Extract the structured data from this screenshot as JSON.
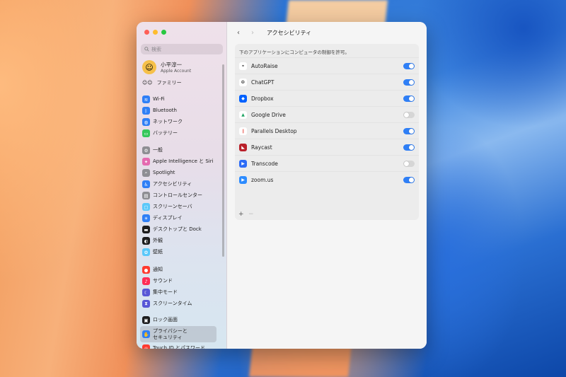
{
  "window": {
    "traffic_colors": [
      "#fe5f57",
      "#febc2e",
      "#28c840"
    ]
  },
  "sidebar": {
    "search_placeholder": "検索",
    "account": {
      "name": "小平淳一",
      "subtitle": "Apple Account",
      "avatar": "memoji-avatar"
    },
    "family": {
      "label": "ファミリー",
      "icon": "family-avatars-icon"
    },
    "groups": [
      [
        {
          "label": "Wi-Fi",
          "icon": "wifi-icon",
          "glyph": "≋",
          "color": "#2f7ff6"
        },
        {
          "label": "Bluetooth",
          "icon": "bluetooth-icon",
          "glyph": "ᛒ",
          "color": "#2f7ff6"
        },
        {
          "label": "ネットワーク",
          "icon": "globe-icon",
          "glyph": "◍",
          "color": "#2f7ff6"
        },
        {
          "label": "バッテリー",
          "icon": "battery-icon",
          "glyph": "▭",
          "color": "#34c759"
        }
      ],
      [
        {
          "label": "一般",
          "icon": "gear-icon",
          "glyph": "⚙",
          "color": "#8e8e93"
        },
        {
          "label": "Apple Intelligence と Siri",
          "icon": "siri-icon",
          "glyph": "✦",
          "color": "#e56ab0"
        },
        {
          "label": "Spotlight",
          "icon": "spotlight-icon",
          "glyph": "⌕",
          "color": "#8e8e93"
        },
        {
          "label": "アクセシビリティ",
          "icon": "accessibility-icon",
          "glyph": "♿",
          "color": "#2f7ff6"
        },
        {
          "label": "コントロールセンター",
          "icon": "control-center-icon",
          "glyph": "▤",
          "color": "#8e8e93"
        },
        {
          "label": "スクリーンセーバ",
          "icon": "screensaver-icon",
          "glyph": "▢",
          "color": "#5ac8fa"
        },
        {
          "label": "ディスプレイ",
          "icon": "display-icon",
          "glyph": "☀",
          "color": "#2f7ff6"
        },
        {
          "label": "デスクトップと Dock",
          "icon": "dock-icon",
          "glyph": "▬",
          "color": "#1c1c1e"
        },
        {
          "label": "外観",
          "icon": "appearance-icon",
          "glyph": "◐",
          "color": "#1c1c1e"
        },
        {
          "label": "壁紙",
          "icon": "wallpaper-icon",
          "glyph": "✿",
          "color": "#5ac8fa"
        }
      ],
      [
        {
          "label": "通知",
          "icon": "notifications-icon",
          "glyph": "●",
          "color": "#ff3b30"
        },
        {
          "label": "サウンド",
          "icon": "sound-icon",
          "glyph": "♪",
          "color": "#ff2d55"
        },
        {
          "label": "集中モード",
          "icon": "focus-icon",
          "glyph": "☾",
          "color": "#5856d6"
        },
        {
          "label": "スクリーンタイム",
          "icon": "screen-time-icon",
          "glyph": "⧗",
          "color": "#5856d6"
        }
      ],
      [
        {
          "label": "ロック画面",
          "icon": "lock-screen-icon",
          "glyph": "▣",
          "color": "#1c1c1e"
        },
        {
          "label": "プライバシーと\nセキュリティ",
          "icon": "privacy-hand-icon",
          "glyph": "✋",
          "color": "#2f7ff6",
          "selected": true
        },
        {
          "label": "Touch ID とパスワード",
          "icon": "touchid-icon",
          "glyph": "◎",
          "color": "#ff3b30"
        }
      ]
    ]
  },
  "content": {
    "title": "アクセシビリティ",
    "back_icon": "chevron-left-icon",
    "forward_icon": "chevron-right-icon",
    "description": "下のアプリケーションにコンピュータの制御を許可。",
    "apps": [
      {
        "name": "AutoRaise",
        "icon": "balloons-icon",
        "glyph": "⚭",
        "color": "#ffffff",
        "fg": "#555",
        "enabled": true
      },
      {
        "name": "ChatGPT",
        "icon": "chatgpt-icon",
        "glyph": "❂",
        "color": "#ffffff",
        "fg": "#333",
        "enabled": true
      },
      {
        "name": "Dropbox",
        "icon": "dropbox-icon",
        "glyph": "◆",
        "color": "#0061ff",
        "fg": "#fff",
        "enabled": true
      },
      {
        "name": "Google Drive",
        "icon": "google-drive-icon",
        "glyph": "▲",
        "color": "#ffffff",
        "fg": "#1fa463",
        "enabled": false
      },
      {
        "name": "Parallels Desktop",
        "icon": "parallels-icon",
        "glyph": "∥",
        "color": "#ffffff",
        "fg": "#e4332a",
        "enabled": true
      },
      {
        "name": "Raycast",
        "icon": "raycast-icon",
        "glyph": "◣",
        "color": "#b9202a",
        "fg": "#fff",
        "enabled": true
      },
      {
        "name": "Transcode",
        "icon": "transcode-icon",
        "glyph": "▶",
        "color": "#2d6cf6",
        "fg": "#fff",
        "enabled": false
      },
      {
        "name": "zoom.us",
        "icon": "zoom-icon",
        "glyph": "▶",
        "color": "#2d8cff",
        "fg": "#fff",
        "enabled": true
      }
    ],
    "add_label": "+",
    "remove_label": "−"
  }
}
